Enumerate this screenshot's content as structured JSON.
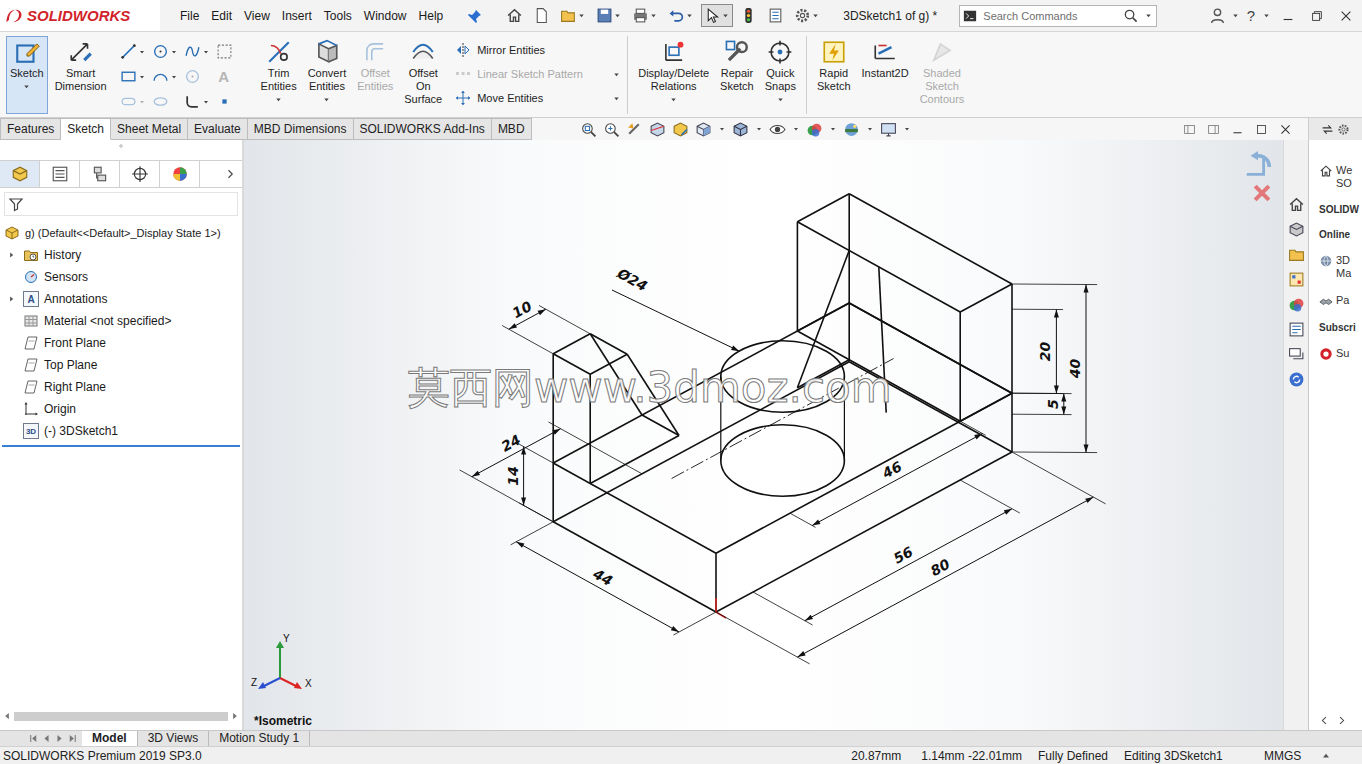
{
  "brand": {
    "name": "SOLIDWORKS"
  },
  "menu": [
    "File",
    "Edit",
    "View",
    "Insert",
    "Tools",
    "Window",
    "Help"
  ],
  "quick_access": [
    {
      "selected": false
    },
    {
      "selected": false
    },
    {
      "selected": false
    },
    {
      "selected": false
    },
    {
      "selected": false
    },
    {
      "selected": false
    },
    {
      "selected": true
    },
    {
      "selected": false
    },
    {
      "selected": false
    },
    {
      "selected": false
    }
  ],
  "window": {
    "title": "3DSketch1 of g) *",
    "help": "?"
  },
  "search": {
    "placeholder": "Search Commands"
  },
  "command_groups": [
    {
      "items": [
        {
          "kind": "large",
          "label": "Sketch",
          "selected": true,
          "disabled": false
        },
        {
          "kind": "large",
          "label": "Smart Dimension",
          "selected": false,
          "disabled": false
        },
        {
          "kind": "grid",
          "tools": [
            {
              "disabled": false
            },
            {
              "disabled": false
            },
            {
              "disabled": false
            },
            {
              "disabled": false
            },
            {
              "disabled": false
            },
            {
              "disabled": false
            },
            {
              "disabled": true
            },
            {
              "disabled": true,
              "glyph": "A"
            },
            {
              "disabled": true
            },
            {
              "disabled": true
            },
            {
              "disabled": false
            },
            {
              "disabled": false
            }
          ]
        },
        {
          "kind": "large",
          "label": "Trim Entities",
          "selected": false,
          "disabled": false
        },
        {
          "kind": "large",
          "label": "Convert Entities",
          "selected": false,
          "disabled": false
        },
        {
          "kind": "large",
          "label": "Offset Entities",
          "selected": false,
          "disabled": true
        },
        {
          "kind": "large",
          "label": "Offset On Surface",
          "selected": false,
          "disabled": false
        },
        {
          "kind": "stack",
          "entries": [
            {
              "label": "Mirror Entities",
              "disabled": false
            },
            {
              "label": "Linear Sketch Pattern",
              "disabled": true
            },
            {
              "label": "Move Entities",
              "disabled": false
            }
          ]
        }
      ]
    },
    {
      "items": [
        {
          "kind": "large",
          "label": "Display/Delete Relations",
          "selected": false,
          "disabled": false
        },
        {
          "kind": "large",
          "label": "Repair Sketch",
          "selected": false,
          "disabled": false
        },
        {
          "kind": "large",
          "label": "Quick Snaps",
          "selected": false,
          "disabled": false
        }
      ]
    },
    {
      "items": [
        {
          "kind": "large",
          "label": "Rapid Sketch",
          "selected": false,
          "disabled": false
        },
        {
          "kind": "large",
          "label": "Instant2D",
          "selected": false,
          "disabled": false
        },
        {
          "kind": "large",
          "label": "Shaded Sketch Contours",
          "selected": false,
          "disabled": true
        }
      ]
    }
  ],
  "tabs": [
    {
      "label": "Features",
      "selected": false
    },
    {
      "label": "Sketch",
      "selected": true
    },
    {
      "label": "Sheet Metal",
      "selected": false
    },
    {
      "label": "Evaluate",
      "selected": false
    },
    {
      "label": "MBD Dimensions",
      "selected": false
    },
    {
      "label": "SOLIDWORKS Add-Ins",
      "selected": false
    },
    {
      "label": "MBD",
      "selected": false
    }
  ],
  "panel_tabs": [
    {
      "selected": true
    },
    {
      "selected": false
    },
    {
      "selected": false
    },
    {
      "selected": false
    },
    {
      "selected": false
    }
  ],
  "feature_tree": {
    "root": "g) (Default<<Default>_Display State 1>)",
    "items": [
      {
        "label": "History",
        "expandable": true,
        "expanded": false
      },
      {
        "label": "Sensors",
        "expandable": false,
        "expanded": false
      },
      {
        "label": "Annotations",
        "expandable": true,
        "expanded": false,
        "icon_text": "A"
      },
      {
        "label": "Material <not specified>",
        "expandable": false,
        "expanded": false
      },
      {
        "label": "Front Plane",
        "expandable": false,
        "expanded": false
      },
      {
        "label": "Top Plane",
        "expandable": false,
        "expanded": false
      },
      {
        "label": "Right Plane",
        "expandable": false,
        "expanded": false
      },
      {
        "label": "Origin",
        "expandable": false,
        "expanded": false
      },
      {
        "label": "(-) 3DSketch1",
        "expandable": false,
        "expanded": false,
        "icon_text": "3D"
      }
    ]
  },
  "viewport": {
    "view_name": "*Isometric",
    "watermark": "莫西网www.3dmoz.com",
    "dimensions": [
      "10",
      "Ø24",
      "24",
      "14",
      "20",
      "5",
      "40",
      "46",
      "56",
      "80",
      "44"
    ],
    "triad": [
      "Y",
      "Z",
      "X"
    ]
  },
  "task_pane": {
    "entries": [
      {
        "kind": "link",
        "lines": [
          "We",
          "SO"
        ]
      },
      {
        "kind": "heading",
        "lines": [
          "SOLIDW"
        ]
      },
      {
        "kind": "heading",
        "lines": [
          "Online"
        ]
      },
      {
        "kind": "link",
        "lines": [
          "3D",
          "Ma"
        ]
      },
      {
        "kind": "link",
        "lines": [
          "Pa"
        ]
      },
      {
        "kind": "heading",
        "lines": [
          "Subscri"
        ]
      },
      {
        "kind": "link",
        "lines": [
          "Su"
        ]
      }
    ]
  },
  "bottom_tabs": [
    {
      "label": "Model",
      "selected": true
    },
    {
      "label": "3D Views",
      "selected": false
    },
    {
      "label": "Motion Study 1",
      "selected": false
    }
  ],
  "status_bar": {
    "product": "SOLIDWORKS Premium 2019 SP3.0",
    "fields": [
      "20.87mm",
      "1.14mm -22.01mm",
      "Fully Defined",
      "Editing 3DSketch1",
      "MMGS"
    ]
  }
}
